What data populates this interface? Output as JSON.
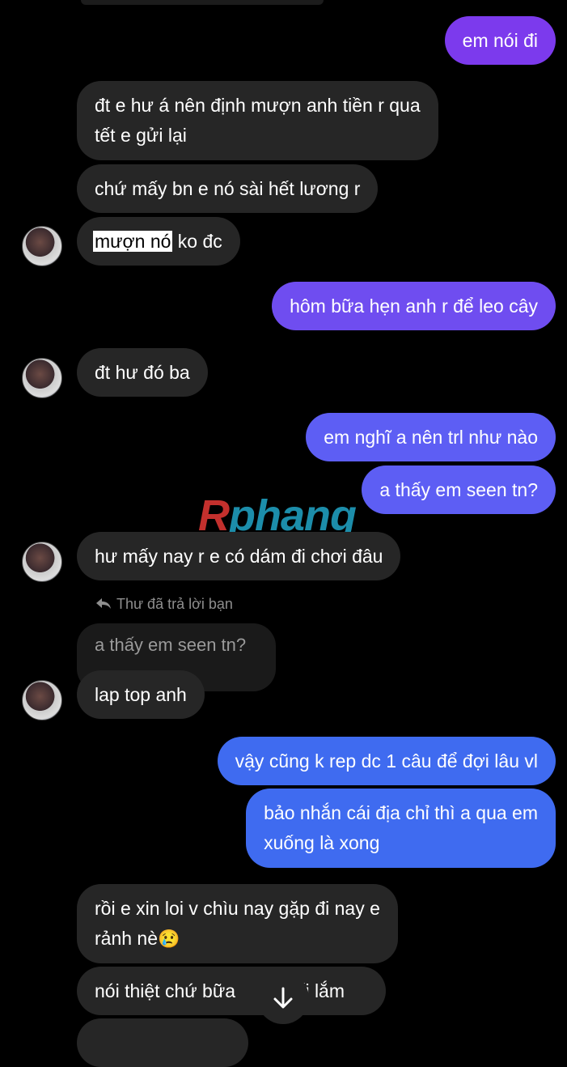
{
  "messages": {
    "m1": "em nói đi",
    "m2_l1": "đt e hư á nên định mượn anh tiền r qua",
    "m2_l2": "tết e gửi lại",
    "m3": "chứ mấy bn e nó sài hết lương r",
    "m4_hl": "mượn nó",
    "m4_rest": " ko đc",
    "m5": "hôm bữa hẹn anh r để leo cây",
    "m6": "đt hư đó ba",
    "m7": "em nghĩ a nên trl như nào",
    "m8": "a thấy em seen tn?",
    "m9": "hư mấy nay r e có dám đi chơi đâu",
    "reply_label": "Thư đã trả lời bạn",
    "reply_quote": "a thấy em seen tn?",
    "m10": "lap top anh",
    "m11": "vậy cũng k rep dc 1 câu để đợi lâu vl",
    "m12_l1": "bảo nhắn cái địa chỉ thì a qua em",
    "m12_l2": "xuống là xong",
    "m13_l1": "rồi e xin loi v chìu nay gặp đi nay e",
    "m13_l2": "rảnh nè",
    "m13_emoji": "😢",
    "m14_a": "nói thiệt chứ bữa",
    "m14_b": "rối lắm"
  },
  "watermark": {
    "r": "R",
    "rest": "phang"
  },
  "icons": {
    "reply": "reply-arrow-icon",
    "scroll": "arrow-down-icon"
  },
  "colors": {
    "received": "#262626",
    "sent_top": "#7c3aed",
    "sent_bottom": "#3f6bf0"
  }
}
